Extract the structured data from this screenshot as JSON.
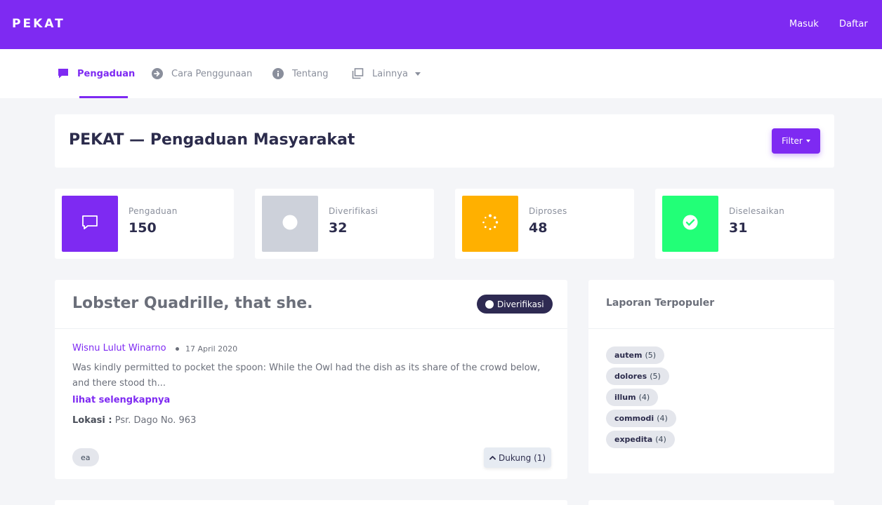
{
  "app": {
    "brand": "PEKAT",
    "top_links": {
      "login": "Masuk",
      "register": "Daftar"
    },
    "accent_color": "#7e2af2"
  },
  "nav": {
    "items": [
      {
        "label": "Pengaduan",
        "icon": "chat-icon",
        "active": true
      },
      {
        "label": "Cara Penggunaan",
        "icon": "arrow-right-circle-icon",
        "active": false
      },
      {
        "label": "Tentang",
        "icon": "info-circle-icon",
        "active": false
      },
      {
        "label": "Lainnya",
        "icon": "windows-icon",
        "active": false,
        "dropdown": true
      }
    ]
  },
  "header": {
    "title": "PEKAT — Pengaduan Masyarakat",
    "filter_label": "Filter"
  },
  "stats": [
    {
      "label": "Pengaduan",
      "value": "150",
      "color": "#7e2af2",
      "icon": "chat-icon"
    },
    {
      "label": "Diverifikasi",
      "value": "32",
      "color": "#cdd1da",
      "icon": "circle-icon"
    },
    {
      "label": "Diproses",
      "value": "48",
      "color": "#ffb000",
      "icon": "spinner-icon"
    },
    {
      "label": "Diselesaikan",
      "value": "31",
      "color": "#22ff77",
      "icon": "check-circle-icon"
    }
  ],
  "report": {
    "title": "Lobster Quadrille, that she.",
    "status": "Diverifikasi",
    "author": "Wisnu Lulut Winarno",
    "date": "17 April 2020",
    "excerpt": "Was kindly permitted to pocket the spoon: While the Owl had the dish as its share of the crowd below, and there stood th...",
    "more_label": "lihat selengkapnya",
    "location_label": "Lokasi :",
    "location_value": "Psr. Dago No. 963",
    "tag": "ea",
    "support_label": "Dukung (1)"
  },
  "sidebar": {
    "title": "Laporan Terpopuler",
    "tags": [
      {
        "name": "autem",
        "count": "(5)"
      },
      {
        "name": "dolores",
        "count": "(5)"
      },
      {
        "name": "illum",
        "count": "(4)"
      },
      {
        "name": "commodi",
        "count": "(4)"
      },
      {
        "name": "expedita",
        "count": "(4)"
      }
    ]
  }
}
